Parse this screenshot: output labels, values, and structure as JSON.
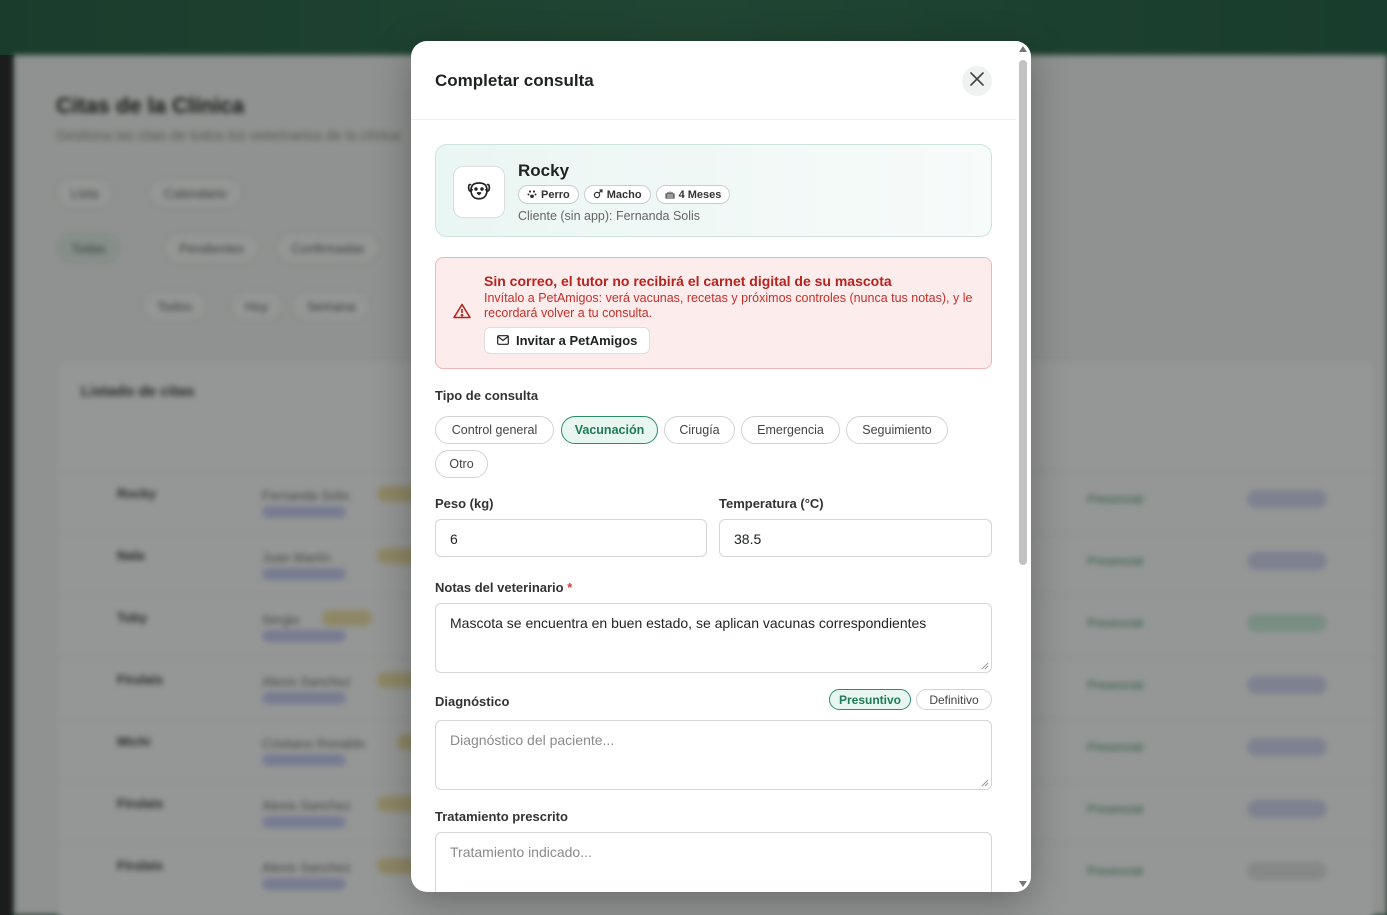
{
  "background": {
    "title": "Citas de la Clínica",
    "subtitle": "Gestiona las citas de todos los veterinarios de la clínica",
    "view_tabs": [
      "Lista",
      "Calendario"
    ],
    "filter_tabs": [
      "Todas",
      "Pendientes",
      "Confirmadas"
    ],
    "date_filter": [
      "Todos",
      "Hoy",
      "Semana"
    ],
    "list_title": "Listado de citas",
    "rows": [
      {
        "pet": "Rocky",
        "owner": "Fernanda Solis",
        "mode": "Presencial"
      },
      {
        "pet": "Nala",
        "owner": "Juan Martín",
        "mode": "Presencial"
      },
      {
        "pet": "Toby",
        "owner": "Sergio",
        "mode": "Presencial"
      },
      {
        "pet": "Firulais",
        "owner": "Alexis Sanchez",
        "mode": "Presencial"
      },
      {
        "pet": "Michi",
        "owner": "Cristiano Ronaldo",
        "mode": "Presencial"
      },
      {
        "pet": "Firulais",
        "owner": "Alexis Sanchez",
        "mode": "Presencial"
      },
      {
        "pet": "Firulais",
        "owner": "Alexis Sanchez",
        "mode": "Presencial"
      }
    ]
  },
  "modal": {
    "title": "Completar consulta",
    "pet": {
      "name": "Rocky",
      "species": "Perro",
      "sex": "Macho",
      "age": "4 Meses",
      "client": "Cliente (sin app): Fernanda Solis"
    },
    "alert": {
      "title": "Sin correo, el tutor no recibirá el carnet digital de su mascota",
      "text": "Invítalo a PetAmigos: verá vacunas, recetas y próximos controles (nunca tus notas), y le recordará volver a tu consulta.",
      "button": "Invitar a PetAmigos"
    },
    "consult_type": {
      "label": "Tipo de consulta",
      "options": [
        "Control general",
        "Vacunación",
        "Cirugía",
        "Emergencia",
        "Seguimiento",
        "Otro"
      ],
      "selected": "Vacunación"
    },
    "weight": {
      "label": "Peso (kg)",
      "value": "6"
    },
    "temperature": {
      "label": "Temperatura (°C)",
      "value": "38.5"
    },
    "notes": {
      "label": "Notas del veterinario",
      "required_mark": "*",
      "value": "Mascota se encuentra en buen estado, se aplican vacunas correspondientes"
    },
    "diagnosis": {
      "label": "Diagnóstico",
      "placeholder": "Diagnóstico del paciente...",
      "options": [
        "Presuntivo",
        "Definitivo"
      ],
      "selected": "Presuntivo"
    },
    "treatment": {
      "label": "Tratamiento prescrito",
      "placeholder": "Tratamiento indicado..."
    }
  },
  "colors": {
    "accent": "#2e8b6a",
    "alert_text": "#b4241f",
    "alert_bg": "#fdecec"
  },
  "icons": {
    "pet_avatar": "dog-face-icon",
    "close": "close-icon",
    "alert": "warning-triangle-icon",
    "invite": "mail-icon",
    "species": "paw-icon",
    "sex": "male-icon",
    "age": "cake-icon"
  }
}
